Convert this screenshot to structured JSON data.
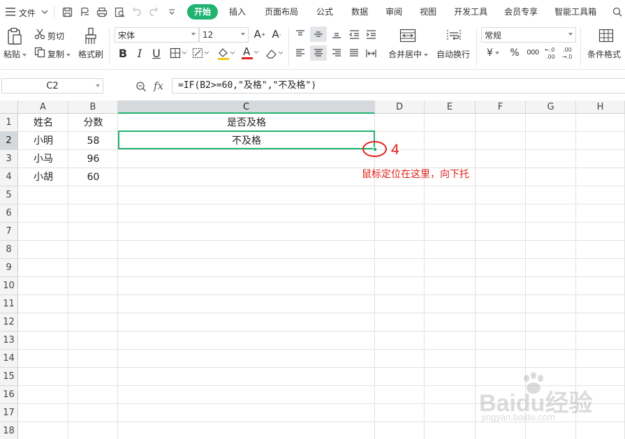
{
  "menubar": {
    "file_label": "文件",
    "tabs": [
      {
        "label": "开始",
        "active": true
      },
      {
        "label": "插入"
      },
      {
        "label": "页面布局"
      },
      {
        "label": "公式"
      },
      {
        "label": "数据"
      },
      {
        "label": "审阅"
      },
      {
        "label": "视图"
      },
      {
        "label": "开发工具"
      },
      {
        "label": "会员专享"
      },
      {
        "label": "智能工具箱"
      }
    ]
  },
  "ribbon": {
    "paste_label": "粘贴",
    "cut_label": "剪切",
    "copy_label": "复制",
    "format_painter_label": "格式刷",
    "font_name": "宋体",
    "font_size": "12",
    "merge_label": "合并居中",
    "wrap_label": "自动换行",
    "number_format": "常规",
    "conditional_label": "条件格式",
    "currency_symbol": "¥",
    "percent_symbol": "%",
    "thousands_symbol": "000",
    "inc_decimal": "+.0\n.00",
    "dec_decimal": ".00\n+.0",
    "accent_color": "#1fb470",
    "font_color_bar": "#e0211b"
  },
  "formula_bar": {
    "name_box": "C2",
    "fx": "fx",
    "formula": "=IF(B2>=60,\"及格\",\"不及格\")"
  },
  "sheet": {
    "columns": [
      "A",
      "B",
      "C",
      "D",
      "E",
      "F",
      "G",
      "H"
    ],
    "rows": [
      "1",
      "2",
      "3",
      "4",
      "5",
      "6",
      "7",
      "8",
      "9",
      "10",
      "11",
      "12",
      "13",
      "14",
      "15",
      "16",
      "17",
      "18"
    ],
    "cells": {
      "A1": "姓名",
      "B1": "分数",
      "C1": "是否及格",
      "A2": "小明",
      "B2": "58",
      "C2": "不及格",
      "A3": "小马",
      "B3": "96",
      "A4": "小胡",
      "B4": "60"
    },
    "active_cell": "C2"
  },
  "annotation": {
    "step_number": "4",
    "hint": "鼠标定位在这里，向下托",
    "color": "#e0211b"
  },
  "watermark": {
    "brand": "Baidu经验",
    "url": "jingyan.baidu.com"
  }
}
